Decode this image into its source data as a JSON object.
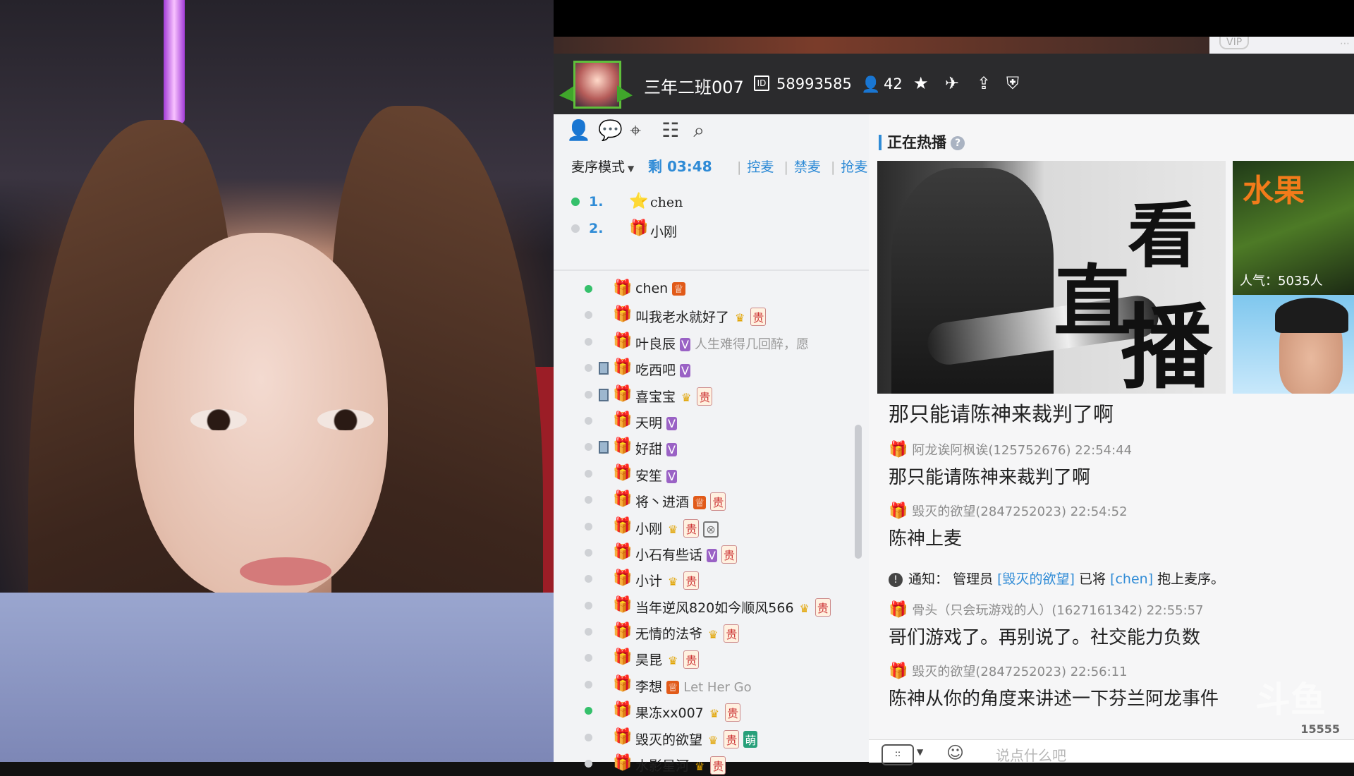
{
  "room": {
    "anchor_name": "三年二班007",
    "id_label": "ID",
    "room_id": "58993585",
    "viewer_count": "42"
  },
  "mic": {
    "mode_label": "麦序模式",
    "timer": "剩 03:48",
    "actions": [
      "控麦",
      "禁麦",
      "抢麦"
    ],
    "queue": [
      {
        "index": "1.",
        "name": "chen",
        "active": true
      },
      {
        "index": "2.",
        "name": "小刚",
        "active": false
      }
    ]
  },
  "users": [
    {
      "name": "chen",
      "online": true,
      "mic": false,
      "tags": [
        "king"
      ],
      "ext": ""
    },
    {
      "name": "叫我老水就好了",
      "online": false,
      "mic": false,
      "tags": [
        "crown",
        "gui"
      ],
      "ext": ""
    },
    {
      "name": "叶良辰",
      "online": false,
      "mic": false,
      "tags": [
        "v"
      ],
      "ext": "人生难得几回醉，愿"
    },
    {
      "name": "吃西吧",
      "online": false,
      "mic": true,
      "tags": [
        "v"
      ],
      "ext": ""
    },
    {
      "name": "喜宝宝",
      "online": false,
      "mic": true,
      "tags": [
        "crown",
        "gui"
      ],
      "ext": ""
    },
    {
      "name": "天明",
      "online": false,
      "mic": false,
      "tags": [
        "v"
      ],
      "ext": ""
    },
    {
      "name": "好甜",
      "online": false,
      "mic": true,
      "tags": [
        "v"
      ],
      "ext": ""
    },
    {
      "name": "安笙",
      "online": false,
      "mic": false,
      "tags": [
        "v"
      ],
      "ext": ""
    },
    {
      "name": "将丶进酒",
      "online": false,
      "mic": false,
      "tags": [
        "king",
        "gui"
      ],
      "ext": ""
    },
    {
      "name": "小刚",
      "online": false,
      "mic": false,
      "tags": [
        "crown",
        "gui",
        "ring"
      ],
      "ext": ""
    },
    {
      "name": "小石有些话",
      "online": false,
      "mic": false,
      "tags": [
        "v",
        "gui"
      ],
      "ext": ""
    },
    {
      "name": "小计",
      "online": false,
      "mic": false,
      "tags": [
        "crown",
        "gui"
      ],
      "ext": ""
    },
    {
      "name": "当年逆风820如今顺风566",
      "online": false,
      "mic": false,
      "tags": [
        "crown",
        "gui"
      ],
      "ext": ""
    },
    {
      "name": "无情的法爷",
      "online": false,
      "mic": false,
      "tags": [
        "crown",
        "gui"
      ],
      "ext": ""
    },
    {
      "name": "昊昆",
      "online": false,
      "mic": false,
      "tags": [
        "crown",
        "gui"
      ],
      "ext": ""
    },
    {
      "name": "李想",
      "online": false,
      "mic": false,
      "tags": [
        "king"
      ],
      "ext": "Let Her Go"
    },
    {
      "name": "果冻xx007",
      "online": true,
      "mic": false,
      "tags": [
        "crown",
        "gui"
      ],
      "ext": ""
    },
    {
      "name": "毁灭的欲望",
      "online": false,
      "mic": false,
      "tags": [
        "crown",
        "gui",
        "meng"
      ],
      "ext": ""
    },
    {
      "name": "水影星河",
      "online": false,
      "mic": false,
      "tags": [
        "crown",
        "gui"
      ],
      "ext": ""
    }
  ],
  "hot": {
    "title": "正在热播",
    "help": "?",
    "hero_text": [
      "直",
      "看",
      "播"
    ],
    "thumb1_logo": "水果",
    "thumb1_popularity": "人气：5035人"
  },
  "chat": {
    "pinned": "那只能请陈神来裁判了啊",
    "messages": [
      {
        "user": "阿龙诶阿枫诶(125752676)",
        "time": "22:54:44",
        "text": "那只能请陈神来裁判了啊"
      },
      {
        "user": "毁灭的欲望(2847252023)",
        "time": "22:54:52",
        "text": "陈神上麦"
      }
    ],
    "notice": {
      "label": "通知：",
      "pre": "管理员",
      "admin": "[毁灭的欲望]",
      "mid": "已将",
      "target": "[chen]",
      "post": "抱上麦序。"
    },
    "messages2": [
      {
        "user": "骨头（只会玩游戏的人）(1627161342)",
        "time": "22:55:57",
        "text": "哥们游戏了。再别说了。社交能力负数"
      },
      {
        "user": "毁灭的欲望(2847252023)",
        "time": "22:56:11",
        "text": "陈神从你的角度来讲述一下芬兰阿龙事件"
      }
    ],
    "input_placeholder": "说点什么吧"
  },
  "watermark": {
    "logo": "斗鱼",
    "number": "15555"
  },
  "colors": {
    "accent": "#2f8bd6",
    "header_bg": "#2b2b2d",
    "online_dot": "#35c06b",
    "offline_dot": "#cfd1d5"
  }
}
